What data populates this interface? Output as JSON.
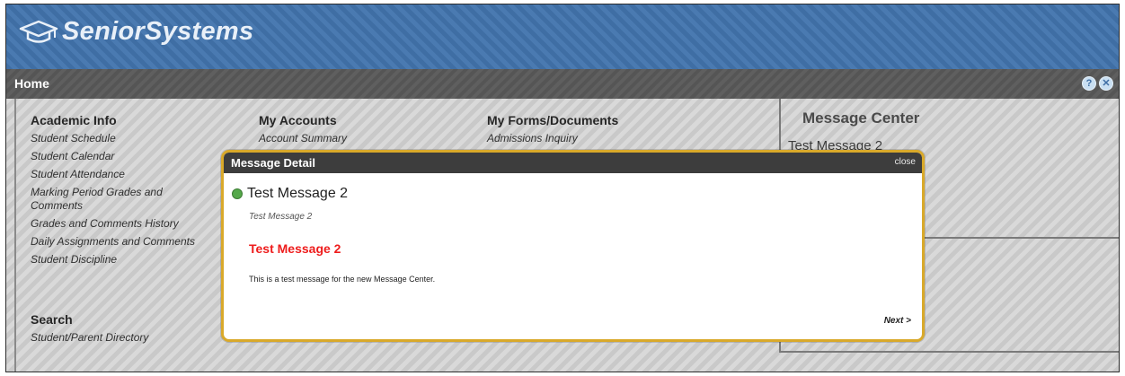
{
  "app": {
    "logo_text": "SeniorSystems"
  },
  "homebar": {
    "title": "Home",
    "help_glyph": "?",
    "close_glyph": "✕"
  },
  "columns": [
    {
      "heading": "Academic Info",
      "links": [
        "Student Schedule",
        "Student Calendar",
        "Student Attendance",
        "Marking Period Grades and Comments",
        "Grades and Comments History",
        "Daily Assignments and Comments",
        "Student Discipline"
      ]
    },
    {
      "heading": "My Accounts",
      "links": [
        "Account Summary"
      ]
    },
    {
      "heading": "My Forms/Documents",
      "links": [
        "Admissions Inquiry"
      ]
    }
  ],
  "search": {
    "heading": "Search",
    "links": [
      "Student/Parent Directory"
    ]
  },
  "message_center": {
    "title": "Message Center",
    "item": "Test Message 2"
  },
  "modal": {
    "title": "Message Detail",
    "close_label": "close",
    "message_title": "Test Message 2",
    "message_subtitle": "Test Message 2",
    "message_heading": "Test Message 2",
    "message_body": "This is a test message for the new Message Center.",
    "next_label": "Next >"
  },
  "colors": {
    "banner": "#3f6ea4",
    "modal_border": "#d9a92a",
    "accent_red": "#ee1c1c",
    "status_dot": "#55a84a"
  }
}
